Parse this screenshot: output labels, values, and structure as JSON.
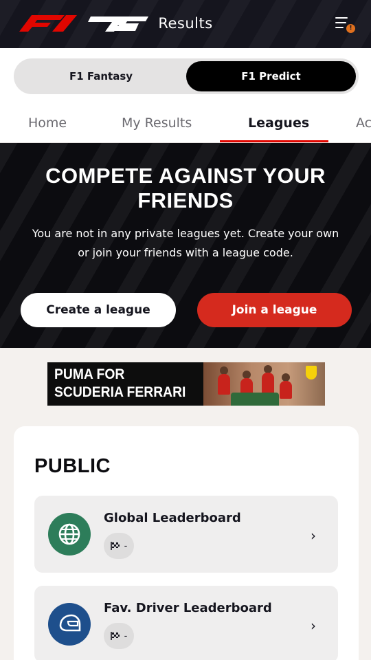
{
  "header": {
    "title": "Results",
    "menu_badge": "!"
  },
  "switcher": {
    "fantasy": "F1 Fantasy",
    "predict": "F1 Predict"
  },
  "tabs": [
    "Home",
    "My Results",
    "Leagues",
    "Ac"
  ],
  "hero": {
    "title_line1": "COMPETE AGAINST YOUR",
    "title_line2": "FRIENDS",
    "text_line1": "You are not in any private leagues yet. Create your own",
    "text_line2": "or join your friends with a league code.",
    "create_button": "Create a league",
    "join_button": "Join a league"
  },
  "ad": {
    "line1": "PUMA FOR",
    "line2": "SCUDERIA FERRARI"
  },
  "public": {
    "title": "PUBLIC",
    "rows": [
      {
        "name": "Global Leaderboard",
        "value": "-",
        "icon": "globe-icon",
        "icon_color": "#2d7d5a"
      },
      {
        "name": "Fav. Driver Leaderboard",
        "value": "-",
        "icon": "helmet-icon",
        "icon_color": "#1e4f8c"
      }
    ]
  },
  "colors": {
    "accent_red": "#e10600",
    "join_button": "#d52a1e",
    "header_bg": "#15151e"
  }
}
